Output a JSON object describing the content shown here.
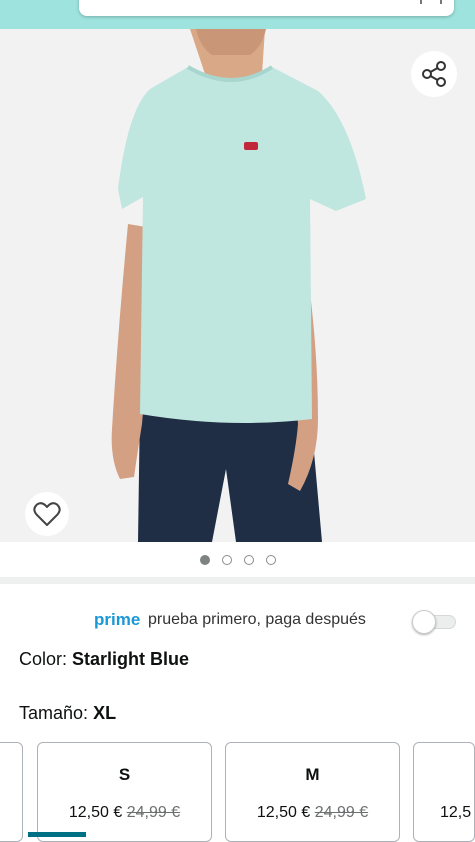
{
  "product": {
    "share_icon": "share-icon",
    "favorite_icon": "heart-icon",
    "image_count": 4,
    "active_image_index": 0
  },
  "prime": {
    "brand": "prime",
    "text": "prueba primero, paga después",
    "toggle_on": false
  },
  "attributes": {
    "color_label": "Color:",
    "color_value": "Starlight Blue",
    "size_label": "Tamaño:",
    "size_value": "XL"
  },
  "sizes": [
    {
      "label": "S",
      "price": "12,50 €",
      "old_price": "24,99 €"
    },
    {
      "label": "M",
      "price": "12,50 €",
      "old_price": "24,99 €"
    },
    {
      "label": "",
      "price": "12,5",
      "old_price": ""
    }
  ],
  "colors": {
    "header_bg": "#9ee3de",
    "prime_blue": "#1a98d5",
    "shirt": "#bfe6df",
    "pants": "#1f2e44"
  }
}
